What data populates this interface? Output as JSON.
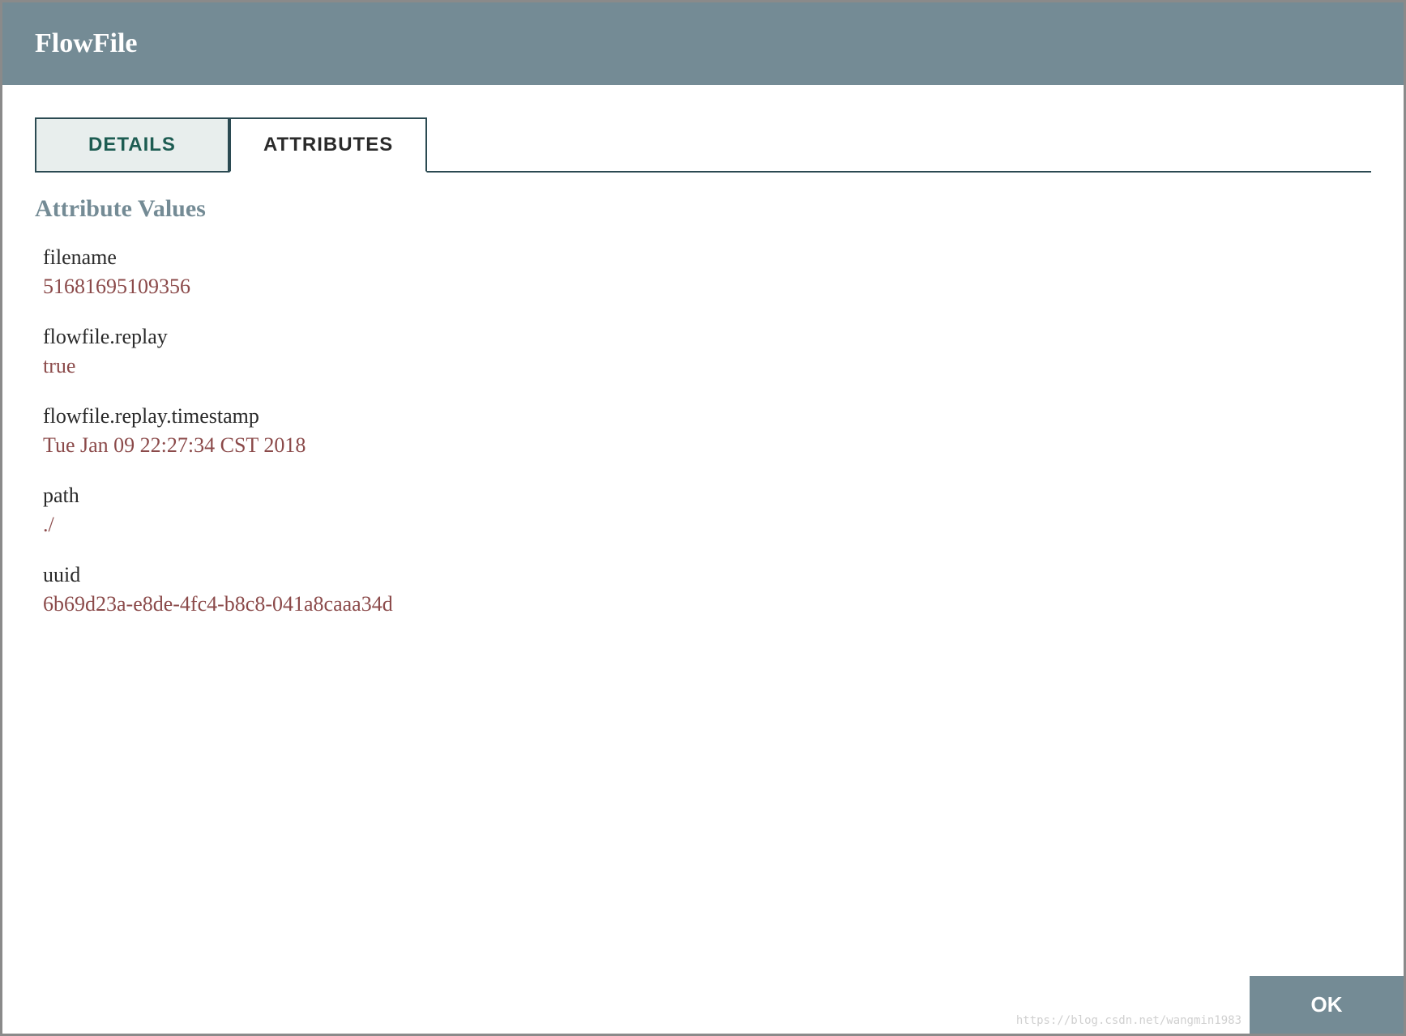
{
  "dialog": {
    "title": "FlowFile"
  },
  "tabs": {
    "details": "DETAILS",
    "attributes": "ATTRIBUTES"
  },
  "section": {
    "title": "Attribute Values"
  },
  "attributes": [
    {
      "name": "filename",
      "value": "51681695109356"
    },
    {
      "name": "flowfile.replay",
      "value": "true"
    },
    {
      "name": "flowfile.replay.timestamp",
      "value": "Tue Jan 09 22:27:34 CST 2018"
    },
    {
      "name": "path",
      "value": "./"
    },
    {
      "name": "uuid",
      "value": "6b69d23a-e8de-4fc4-b8c8-041a8caaa34d"
    }
  ],
  "footer": {
    "ok": "OK"
  },
  "watermark": "https://blog.csdn.net/wangmin1983"
}
